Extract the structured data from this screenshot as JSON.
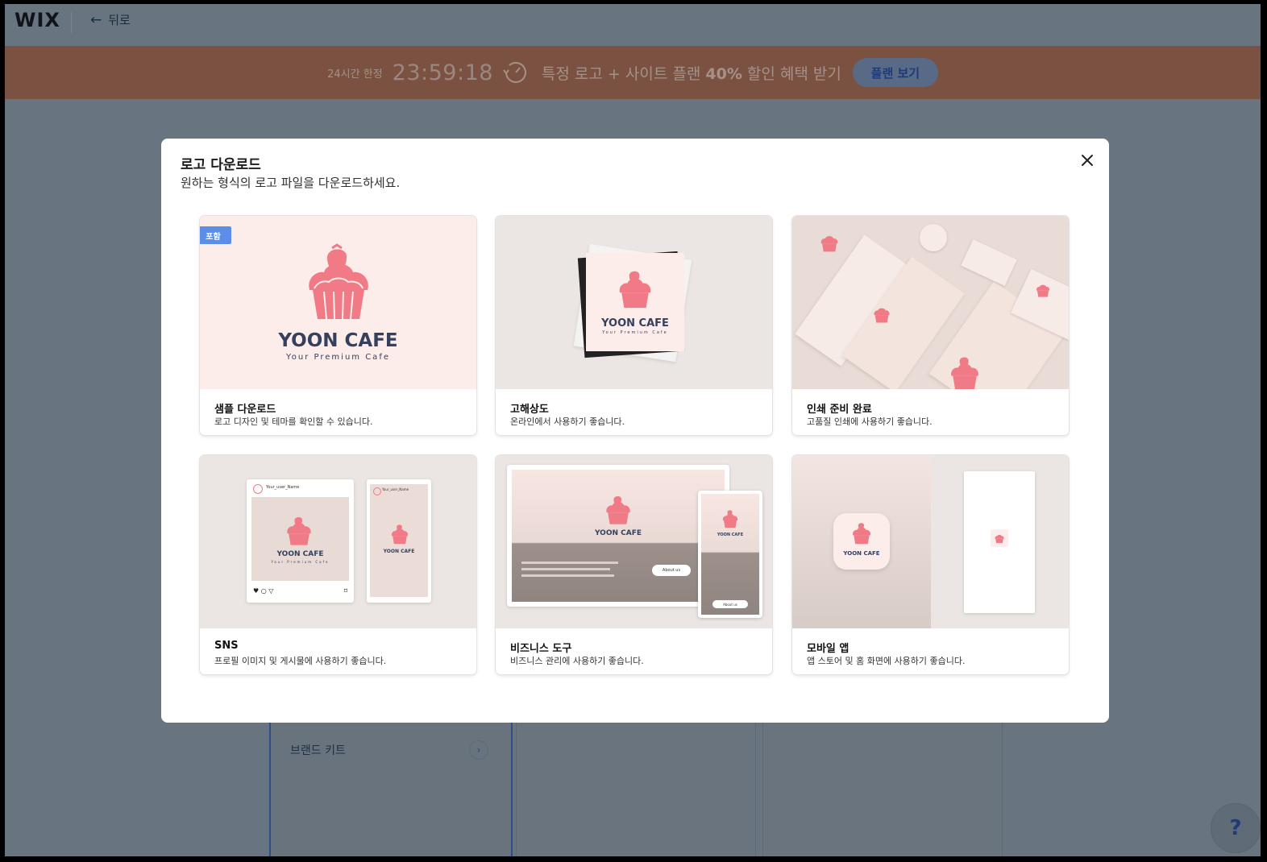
{
  "topbar": {
    "logo": "WIX",
    "back_label": "뒤로"
  },
  "promo": {
    "limit": "24시간 한정",
    "timer": "23:59:18",
    "offer_prefix": "특정 로고 + 사이트 플랜 ",
    "offer_pct": "40%",
    "offer_suffix": " 할인 혜택 받기",
    "button": "플랜 보기"
  },
  "background": {
    "brand_kit_label": "브랜드 키트",
    "help": "?"
  },
  "modal": {
    "title": "로고 다운로드",
    "subtitle": "원하는 형식의 로고 파일을 다운로드하세요.",
    "included_badge": "포함",
    "brand": {
      "name": "YOON CAFE",
      "tagline": "Your Premium Cafe"
    },
    "cards": [
      {
        "name": "샘플 다운로드",
        "desc": "로고 디자인 및 테마를 확인할 수 있습니다."
      },
      {
        "name": "고해상도",
        "desc": "온라인에서 사용하기 좋습니다."
      },
      {
        "name": "인쇄 준비 완료",
        "desc": "고품질 인쇄에 사용하기 좋습니다."
      },
      {
        "name": "SNS",
        "desc": "프로필 이미지 및 게시물에 사용하기 좋습니다."
      },
      {
        "name": "비즈니스 도구",
        "desc": "비즈니스 관리에 사용하기 좋습니다."
      },
      {
        "name": "모바일 앱",
        "desc": "앱 스토어 및 홈 화면에 사용하기 좋습니다."
      }
    ],
    "mockup_texts": {
      "sns_user": "Your_user_Name",
      "sns_user2": "Your_user_Name",
      "about_button": "About us"
    }
  },
  "colors": {
    "accent": "#5c8ee8",
    "promo_bg": "#7b5242",
    "cupcake": "#f07a86",
    "brand_text": "#34405e"
  }
}
